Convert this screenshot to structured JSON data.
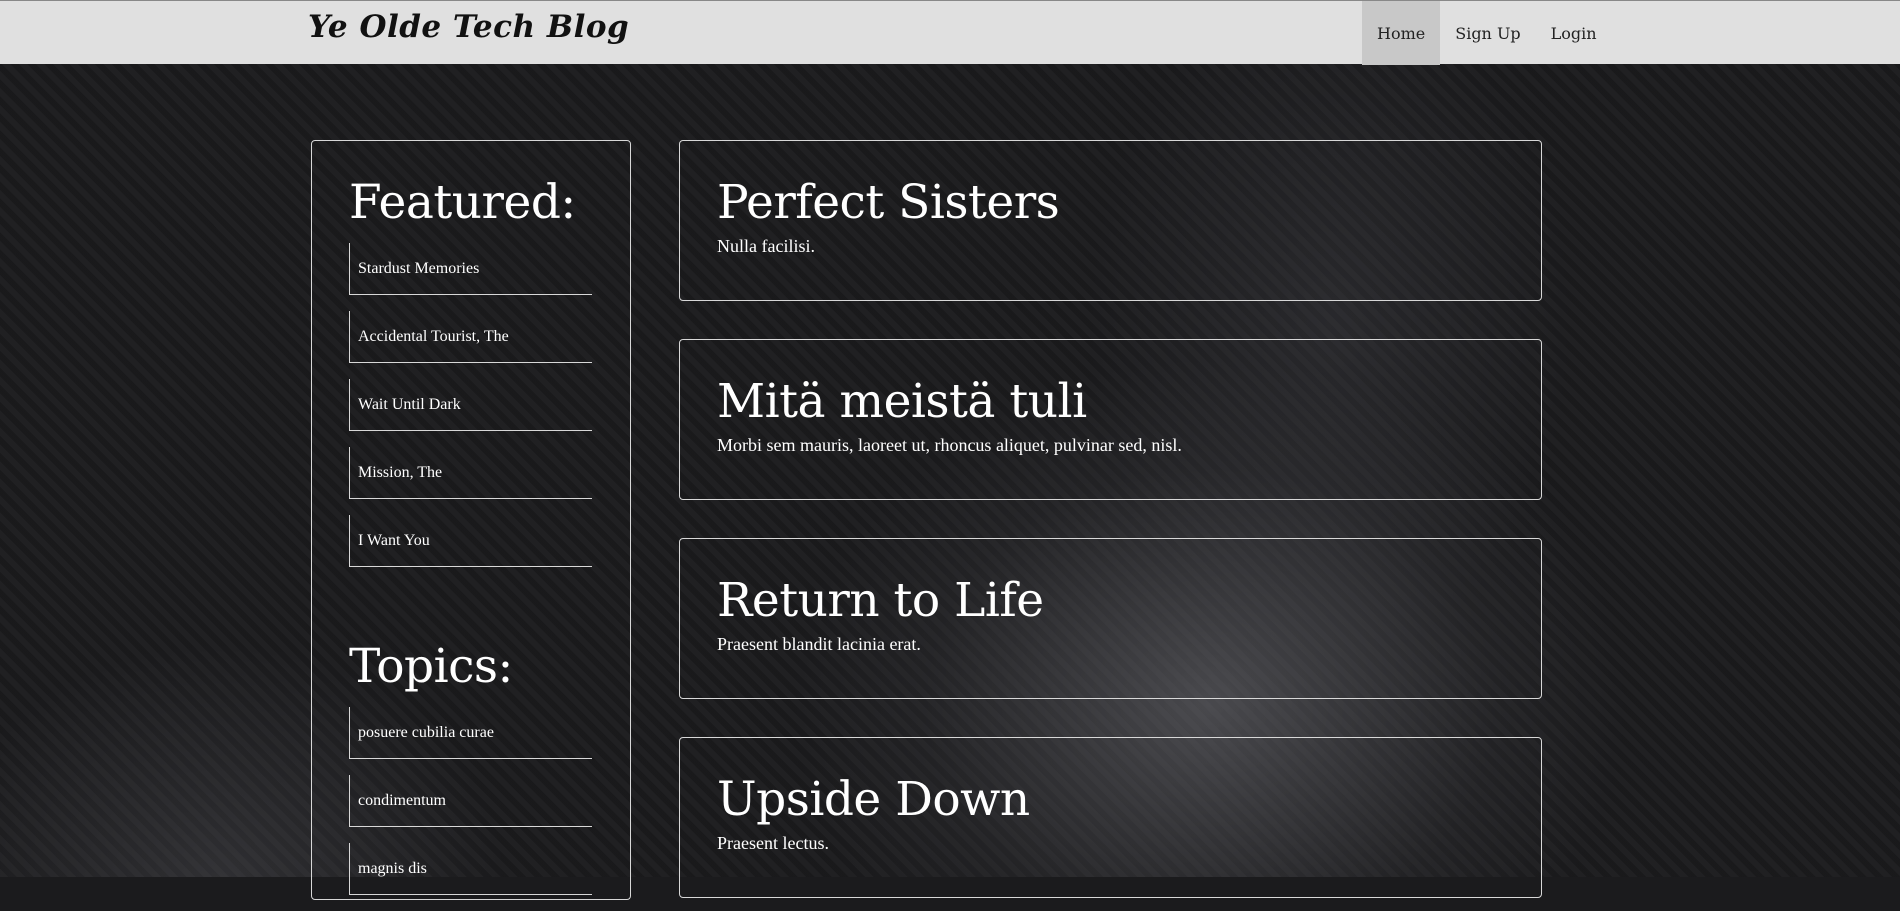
{
  "navbar": {
    "brand": "Ye Olde Tech Blog",
    "links": [
      {
        "label": "Home",
        "active": true
      },
      {
        "label": "Sign Up",
        "active": false
      },
      {
        "label": "Login",
        "active": false
      }
    ]
  },
  "sidebar": {
    "featured_heading": "Featured:",
    "featured": [
      "Stardust Memories",
      "Accidental Tourist, The",
      "Wait Until Dark",
      "Mission, The",
      "I Want You"
    ],
    "topics_heading": "Topics:",
    "topics": [
      "posuere cubilia curae",
      "condimentum",
      "magnis dis"
    ]
  },
  "posts": [
    {
      "title": "Perfect Sisters",
      "body": "Nulla facilisi."
    },
    {
      "title": "Mitä meistä tuli",
      "body": "Morbi sem mauris, laoreet ut, rhoncus aliquet, pulvinar sed, nisl."
    },
    {
      "title": "Return to Life",
      "body": "Praesent blandit lacinia erat."
    },
    {
      "title": "Upside Down",
      "body": "Praesent lectus."
    }
  ],
  "colors": {
    "background": "#1b1b1d",
    "navbar": "#e0e0e0",
    "active_nav": "#c8c8c8",
    "border": "#d8d8d8"
  }
}
